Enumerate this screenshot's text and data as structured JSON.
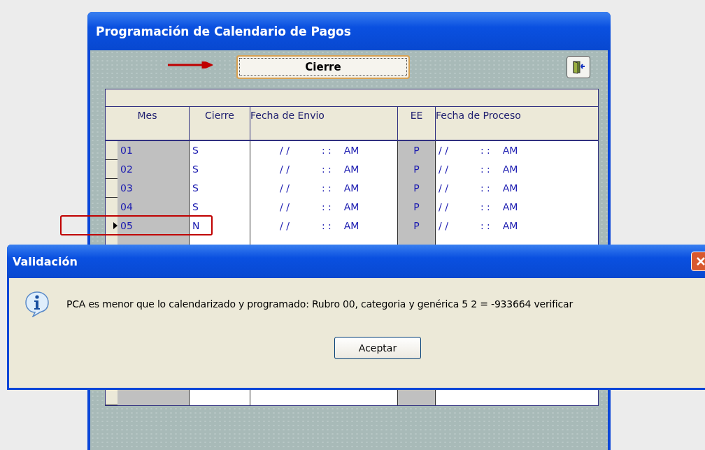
{
  "window": {
    "title": "Programación de Calendario de Pagos"
  },
  "toolbar": {
    "close_button": "Cierre"
  },
  "table": {
    "columns": [
      "Mes",
      "Cierre",
      "Fecha de Envio",
      "EE",
      "Fecha de Proceso"
    ],
    "rows": [
      {
        "mes": "01",
        "cierre": "S",
        "envio_date": "/ /",
        "envio_time": ": :",
        "envio_ampm": "AM",
        "ee": "P",
        "proceso_date": "/ /",
        "proceso_time": ": :",
        "proceso_ampm": "AM",
        "selected": false
      },
      {
        "mes": "02",
        "cierre": "S",
        "envio_date": "/ /",
        "envio_time": ": :",
        "envio_ampm": "AM",
        "ee": "P",
        "proceso_date": "/ /",
        "proceso_time": ": :",
        "proceso_ampm": "AM",
        "selected": false
      },
      {
        "mes": "03",
        "cierre": "S",
        "envio_date": "/ /",
        "envio_time": ": :",
        "envio_ampm": "AM",
        "ee": "P",
        "proceso_date": "/ /",
        "proceso_time": ": :",
        "proceso_ampm": "AM",
        "selected": false
      },
      {
        "mes": "04",
        "cierre": "S",
        "envio_date": "/ /",
        "envio_time": ": :",
        "envio_ampm": "AM",
        "ee": "P",
        "proceso_date": "/ /",
        "proceso_time": ": :",
        "proceso_ampm": "AM",
        "selected": false
      },
      {
        "mes": "05",
        "cierre": "N",
        "envio_date": "/ /",
        "envio_time": ": :",
        "envio_ampm": "AM",
        "ee": "P",
        "proceso_date": "/ /",
        "proceso_time": ": :",
        "proceso_ampm": "AM",
        "selected": true
      }
    ]
  },
  "dialog": {
    "title": "Validación",
    "message": "PCA es menor que lo calendarizado y programado: Rubro 00, categoria y genérica 5 2 = -933664 verificar",
    "button": "Aceptar"
  }
}
